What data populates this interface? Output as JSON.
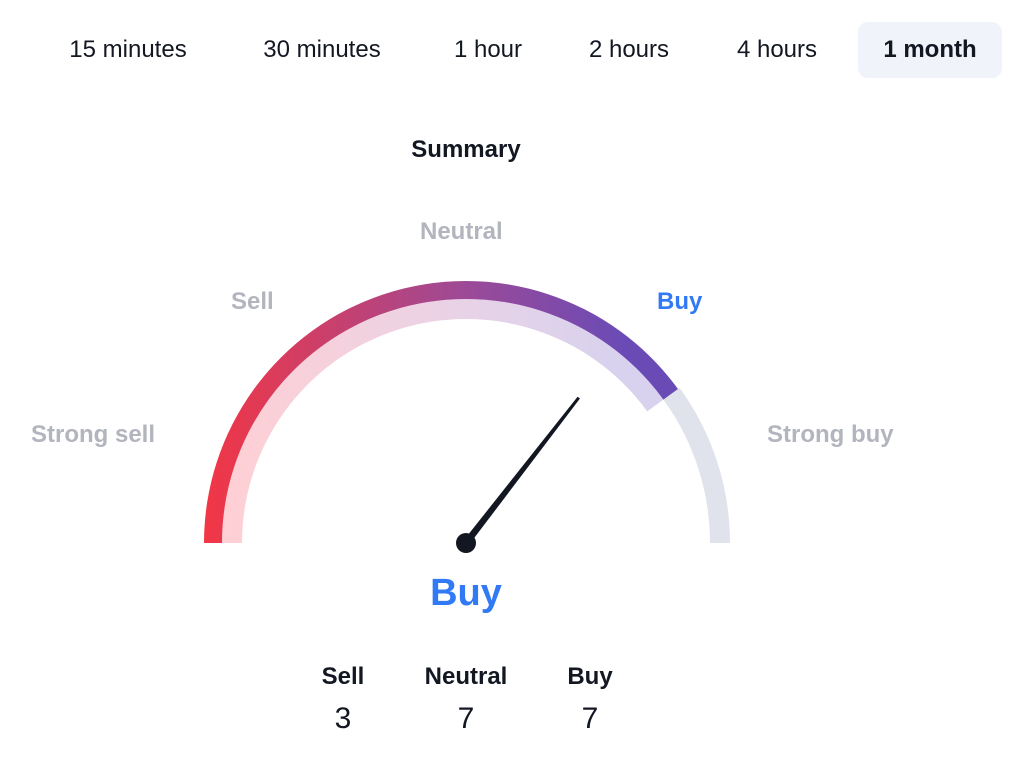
{
  "tabs": [
    {
      "label": "15 minutes",
      "active": false
    },
    {
      "label": "30 minutes",
      "active": false
    },
    {
      "label": "1 hour",
      "active": false
    },
    {
      "label": "2 hours",
      "active": false
    },
    {
      "label": "4 hours",
      "active": false
    },
    {
      "label": "1 month",
      "active": true
    }
  ],
  "summary": {
    "title": "Summary",
    "gauge_labels": {
      "strong_sell": "Strong sell",
      "sell": "Sell",
      "neutral": "Neutral",
      "buy": "Buy",
      "strong_buy": "Strong buy"
    },
    "active_label": "buy",
    "needle_value": 0.71,
    "filled_fraction": 0.8,
    "result": "Buy",
    "counts": [
      {
        "label": "Sell",
        "value": "3"
      },
      {
        "label": "Neutral",
        "value": "7"
      },
      {
        "label": "Buy",
        "value": "7"
      }
    ]
  },
  "colors": {
    "accent_blue": "#3179f5",
    "gauge_start": "#f23645",
    "gauge_mid": "#9c4a97",
    "gauge_end": "#6a4bb6",
    "track": "#e0e3eb",
    "needle": "#131722"
  }
}
